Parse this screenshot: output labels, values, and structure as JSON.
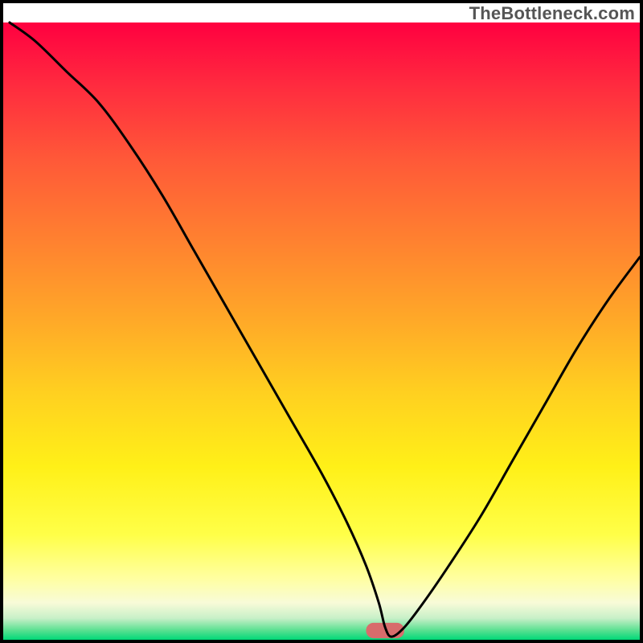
{
  "watermark": {
    "text": "TheBottleneck.com"
  },
  "chart_data": {
    "type": "line",
    "title": "",
    "xlabel": "",
    "ylabel": "",
    "xlim": [
      0,
      100
    ],
    "ylim": [
      0,
      100
    ],
    "grid": false,
    "background": {
      "type": "vertical-gradient",
      "stops": [
        {
          "pos": 0.0,
          "color": "#ff0040"
        },
        {
          "pos": 0.1,
          "color": "#ff2a3f"
        },
        {
          "pos": 0.22,
          "color": "#ff5838"
        },
        {
          "pos": 0.35,
          "color": "#ff8030"
        },
        {
          "pos": 0.48,
          "color": "#ffa828"
        },
        {
          "pos": 0.6,
          "color": "#ffd020"
        },
        {
          "pos": 0.72,
          "color": "#fff018"
        },
        {
          "pos": 0.83,
          "color": "#ffff48"
        },
        {
          "pos": 0.9,
          "color": "#ffffa0"
        },
        {
          "pos": 0.94,
          "color": "#f8fbd8"
        },
        {
          "pos": 0.965,
          "color": "#c8f0c8"
        },
        {
          "pos": 0.985,
          "color": "#58e090"
        },
        {
          "pos": 1.0,
          "color": "#00d878"
        }
      ]
    },
    "marker": {
      "x": 60,
      "y": 1.5,
      "width": 6,
      "height": 2.5,
      "color": "#d86c6c",
      "rx": 1.2
    },
    "series": [
      {
        "name": "curve",
        "x": [
          1,
          5,
          10,
          15,
          20,
          25,
          30,
          35,
          40,
          45,
          50,
          54,
          57,
          59,
          60,
          61,
          63,
          66,
          70,
          75,
          80,
          85,
          90,
          95,
          100
        ],
        "y": [
          100,
          97,
          92,
          87,
          80,
          72,
          63,
          54,
          45,
          36,
          27,
          19,
          12,
          6,
          2,
          0.5,
          2,
          6,
          12,
          20,
          29,
          38,
          47,
          55,
          62
        ]
      }
    ]
  }
}
